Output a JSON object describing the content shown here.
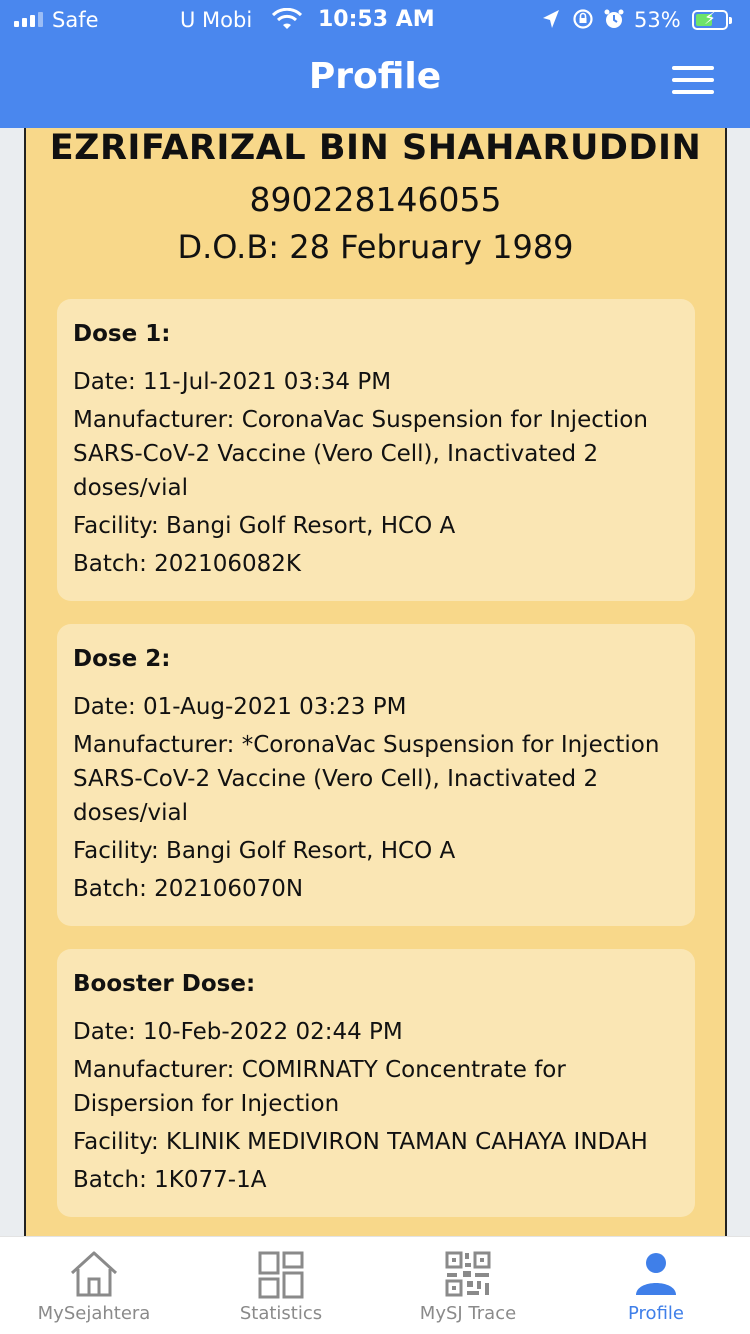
{
  "status_bar": {
    "carrier_left": "Safe",
    "carrier_right": "U Mobi",
    "time": "10:53 AM",
    "battery": "53%"
  },
  "header": {
    "title": "Profile",
    "menu_icon": "hamburger-menu-icon"
  },
  "profile": {
    "name": "EZRIFARIZAL BIN SHAHARUDDIN",
    "ic_number": "890228146055",
    "dob": "D.O.B: 28 February 1989"
  },
  "doses": [
    {
      "title": "Dose 1:",
      "date": "Date: 11-Jul-2021 03:34 PM",
      "manufacturer": "Manufacturer: CoronaVac Suspension for Injection SARS-CoV-2 Vaccine (Vero Cell), Inactivated 2 doses/vial",
      "facility": "Facility: Bangi Golf Resort, HCO A",
      "batch": "Batch: 202106082K"
    },
    {
      "title": "Dose 2:",
      "date": "Date: 01-Aug-2021 03:23 PM",
      "manufacturer": "Manufacturer: *CoronaVac Suspension for Injection SARS-CoV-2 Vaccine (Vero Cell), Inactivated 2 doses/vial",
      "facility": "Facility: Bangi Golf Resort, HCO A",
      "batch": "Batch: 202106070N"
    },
    {
      "title": "Booster Dose:",
      "date": "Date: 10-Feb-2022 02:44 PM",
      "manufacturer": "Manufacturer: COMIRNATY Concentrate for Dispersion for Injection",
      "facility": "Facility: KLINIK MEDIVIRON TAMAN CAHAYA INDAH",
      "batch": "Batch: 1K077-1A"
    }
  ],
  "tabbar": {
    "items": [
      {
        "label": "MySejahtera",
        "icon": "home-icon",
        "active": false
      },
      {
        "label": "Statistics",
        "icon": "grid-icon",
        "active": false
      },
      {
        "label": "MySJ Trace",
        "icon": "qr-code-icon",
        "active": false
      },
      {
        "label": "Profile",
        "icon": "person-icon",
        "active": true
      }
    ]
  },
  "colors": {
    "header_blue": "#4a87ee",
    "card_yellow": "#f8d88a",
    "dose_panel": "#fae6b4",
    "tab_active": "#3f7fe9",
    "tab_inactive": "#8a8a8a"
  }
}
